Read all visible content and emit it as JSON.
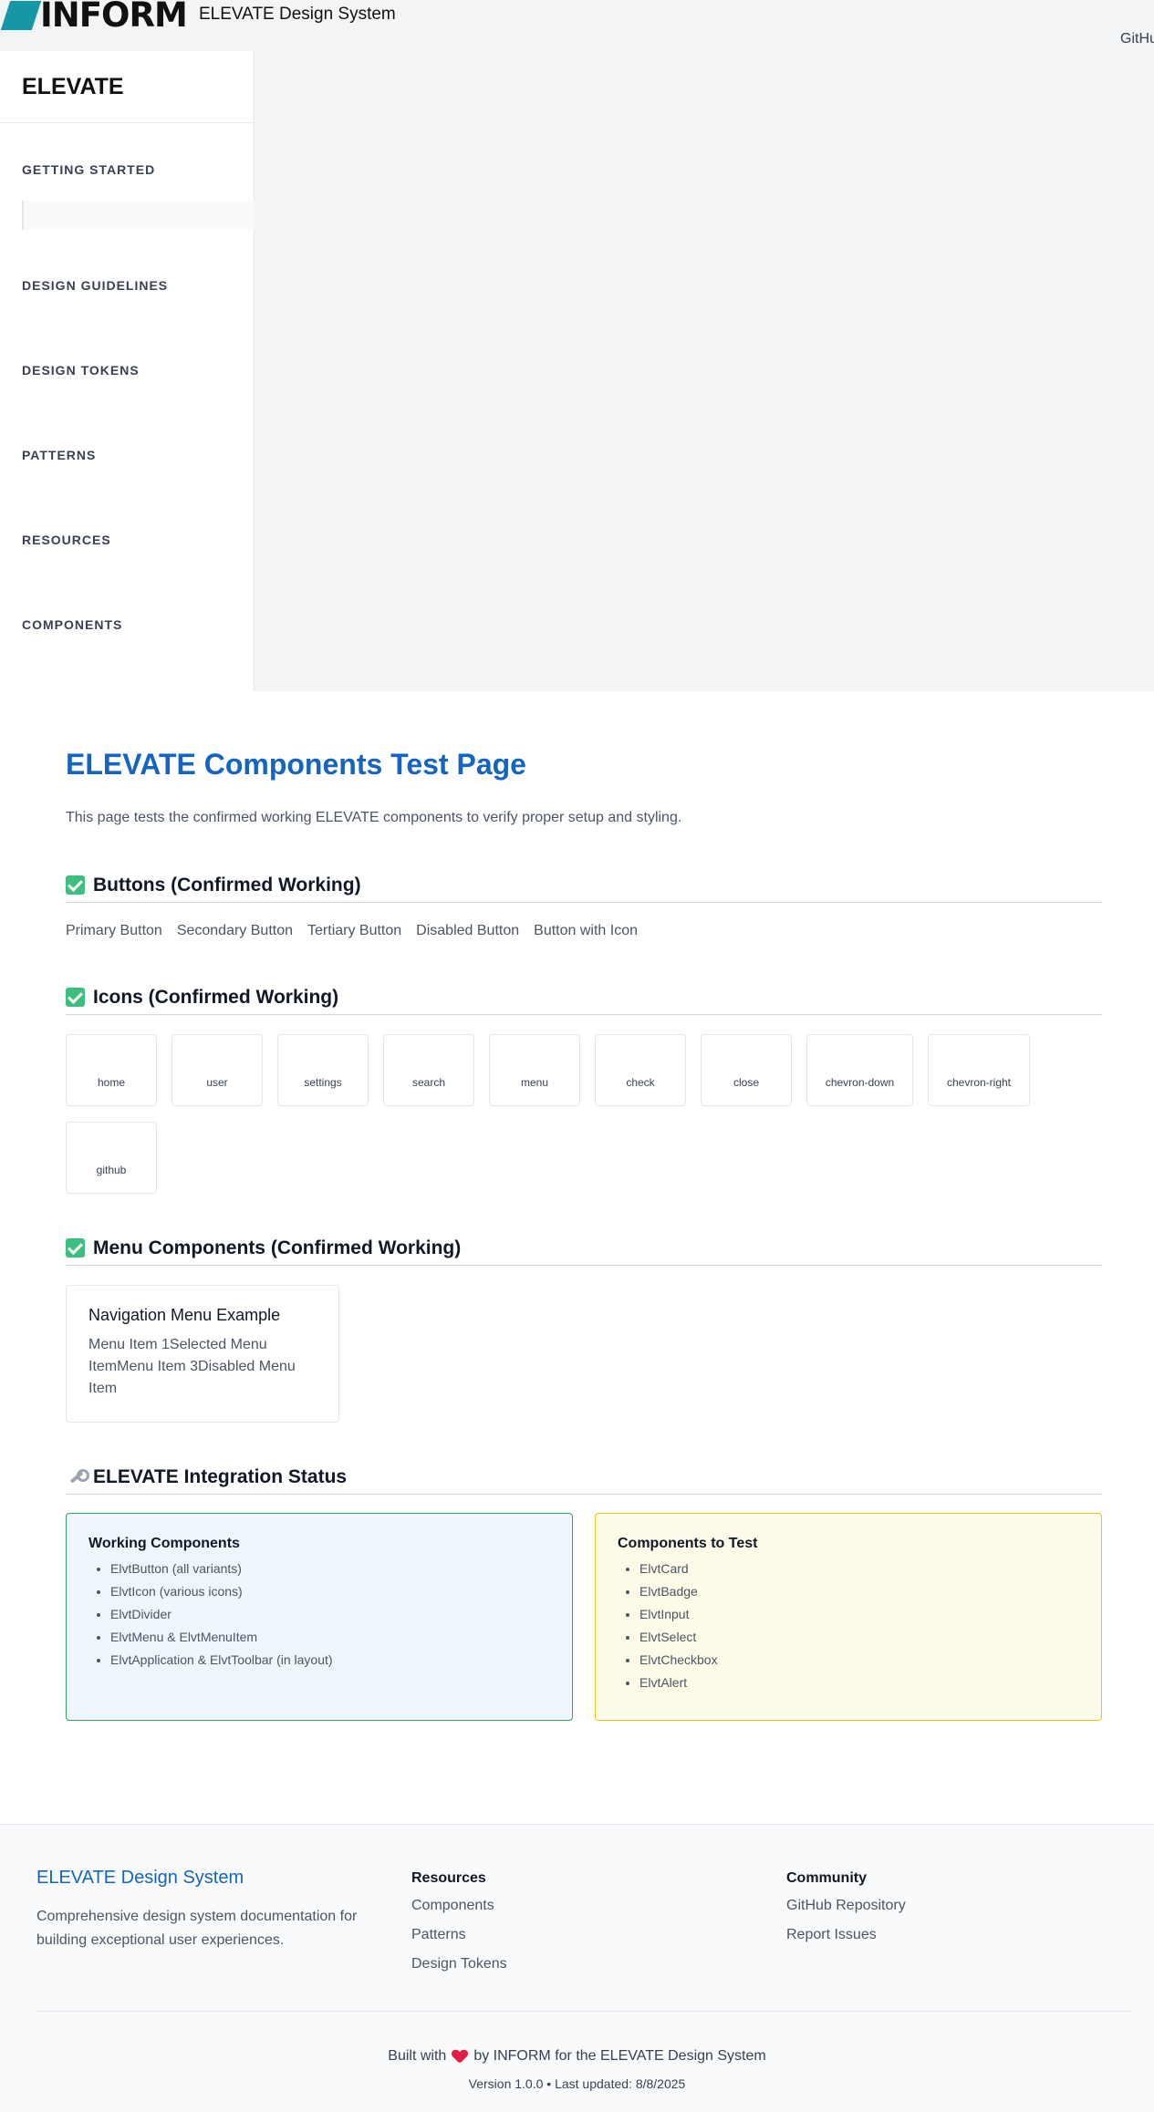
{
  "header": {
    "logo_text": "INFORM",
    "app_title": "ELEVATE Design System",
    "github_link": "GitHub"
  },
  "sidebar": {
    "brand": "ELEVATE",
    "sections": [
      "GETTING STARTED",
      "DESIGN GUIDELINES",
      "DESIGN TOKENS",
      "PATTERNS",
      "RESOURCES",
      "COMPONENTS"
    ]
  },
  "main": {
    "title": "ELEVATE Components Test Page",
    "intro": "This page tests the confirmed working ELEVATE components to verify proper setup and styling.",
    "buttons_section": {
      "title": "Buttons (Confirmed Working)",
      "buttons": [
        "Primary Button",
        "Secondary Button",
        "Tertiary Button",
        "Disabled Button",
        "Button with Icon"
      ]
    },
    "icons_section": {
      "title": "Icons (Confirmed Working)",
      "icons": [
        "home",
        "user",
        "settings",
        "search",
        "menu",
        "check",
        "close",
        "chevron-down",
        "chevron-right",
        "github"
      ]
    },
    "menu_section": {
      "title": "Menu Components (Confirmed Working)",
      "card_title": "Navigation Menu Example",
      "menu_text": "Menu Item 1Selected Menu ItemMenu Item 3Disabled Menu Item"
    },
    "status_section": {
      "title": "ELEVATE Integration Status",
      "working": {
        "title": "Working Components",
        "items": [
          "ElvtButton (all variants)",
          "ElvtIcon (various icons)",
          "ElvtDivider",
          "ElvtMenu & ElvtMenuItem",
          "ElvtApplication & ElvtToolbar (in layout)"
        ]
      },
      "to_test": {
        "title": "Components to Test",
        "items": [
          "ElvtCard",
          "ElvtBadge",
          "ElvtInput",
          "ElvtSelect",
          "ElvtCheckbox",
          "ElvtAlert"
        ]
      }
    }
  },
  "footer": {
    "brand": "ELEVATE Design System",
    "description": "Comprehensive design system documentation for building exceptional user experiences.",
    "resources": {
      "title": "Resources",
      "links": [
        "Components",
        "Patterns",
        "Design Tokens"
      ]
    },
    "community": {
      "title": "Community",
      "links": [
        "GitHub Repository",
        "Report Issues"
      ]
    },
    "built_prefix": "Built with",
    "built_suffix": "by INFORM for the ELEVATE Design System",
    "version": "Version 1.0.0 • Last updated: 8/8/2025"
  },
  "colors": {
    "brand_blue": "#1565c0",
    "logo_teal": "#1697a6",
    "success_green": "#3fbf7f",
    "warning_yellow": "#f3c21a"
  }
}
